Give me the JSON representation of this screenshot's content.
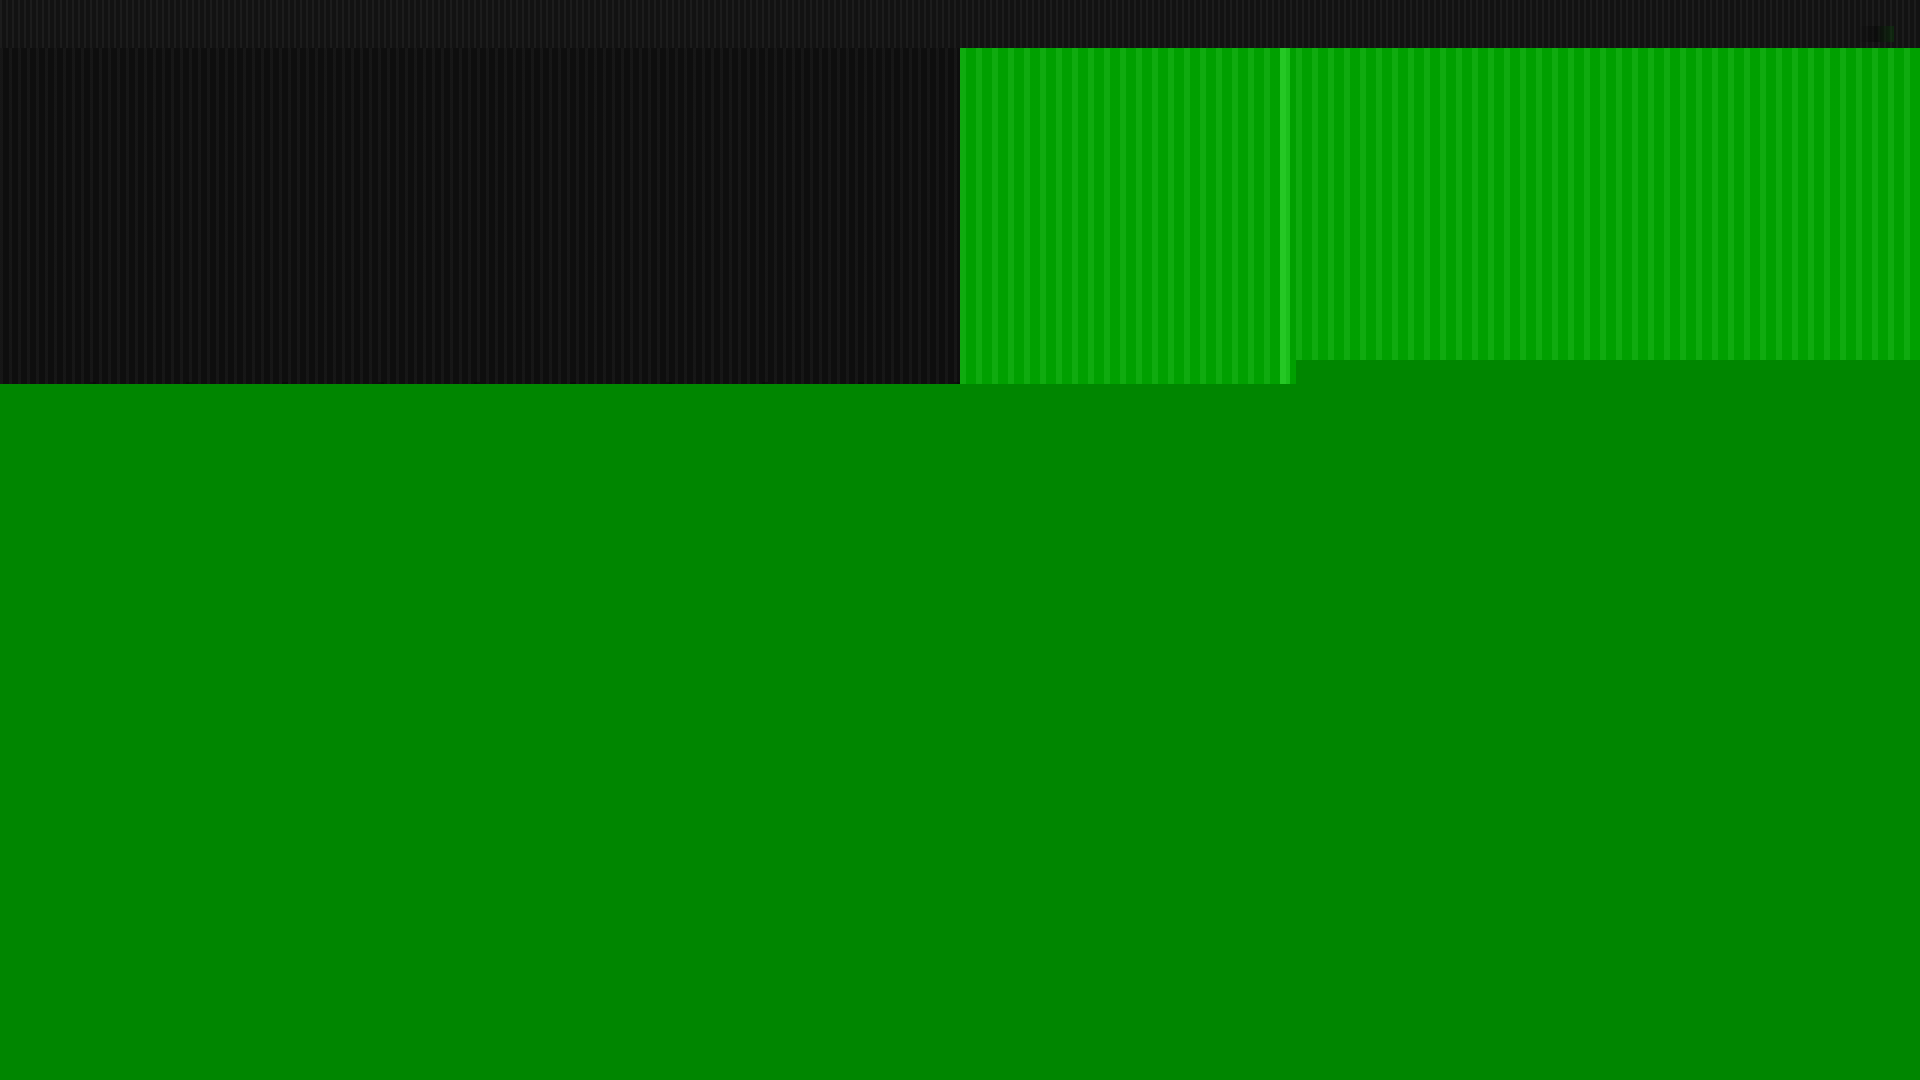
{
  "colors": {
    "dark_panel": "#121212",
    "top_strip": "#151515",
    "bright_green": "#00a600",
    "main_green": "#008600"
  }
}
